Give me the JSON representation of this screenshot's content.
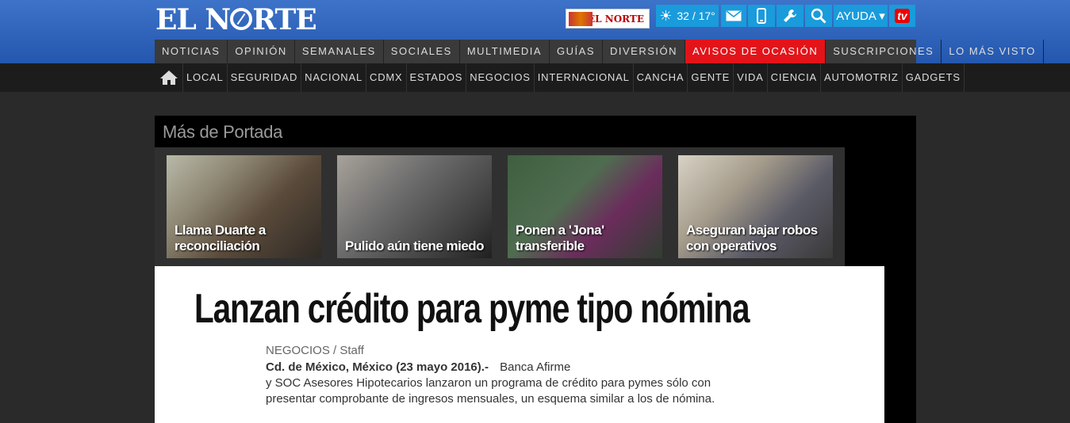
{
  "header": {
    "logo": "EL NORTE",
    "paper_thumb": "EL NORTE",
    "weather": "32 / 17°",
    "help_label": "AYUDA ▾",
    "tv_label": "tv"
  },
  "nav_primary": [
    "NOTICIAS",
    "OPINIÓN",
    "SEMANALES",
    "SOCIALES",
    "MULTIMEDIA",
    "GUÍAS",
    "DIVERSIÓN",
    "AVISOS DE OCASIÓN",
    "SUSCRIPCIONES",
    "LO MÁS VISTO"
  ],
  "nav_secondary": [
    "LOCAL",
    "SEGURIDAD",
    "NACIONAL",
    "CDMX",
    "ESTADOS",
    "NEGOCIOS",
    "INTERNACIONAL",
    "CANCHA",
    "GENTE",
    "VIDA",
    "CIENCIA",
    "AUTOMOTRIZ",
    "GADGETS"
  ],
  "mas_portada": {
    "title": "Más de Portada",
    "cards": [
      "Llama Duarte a reconciliación",
      "Pulido aún tiene miedo",
      "Ponen a 'Jona' transferible",
      "Aseguran bajar robos con operativos"
    ]
  },
  "article": {
    "headline": "Lanzan crédito para pyme tipo nómina",
    "byline": "NEGOCIOS / Staff",
    "dateline": "Cd. de México, México (23 mayo 2016).-",
    "lead": "Banca Afirme",
    "body": "y SOC Asesores Hipotecarios lanzaron un programa de crédito para pymes sólo con presentar comprobante de ingresos mensuales, un esquema similar a los de nómina."
  }
}
